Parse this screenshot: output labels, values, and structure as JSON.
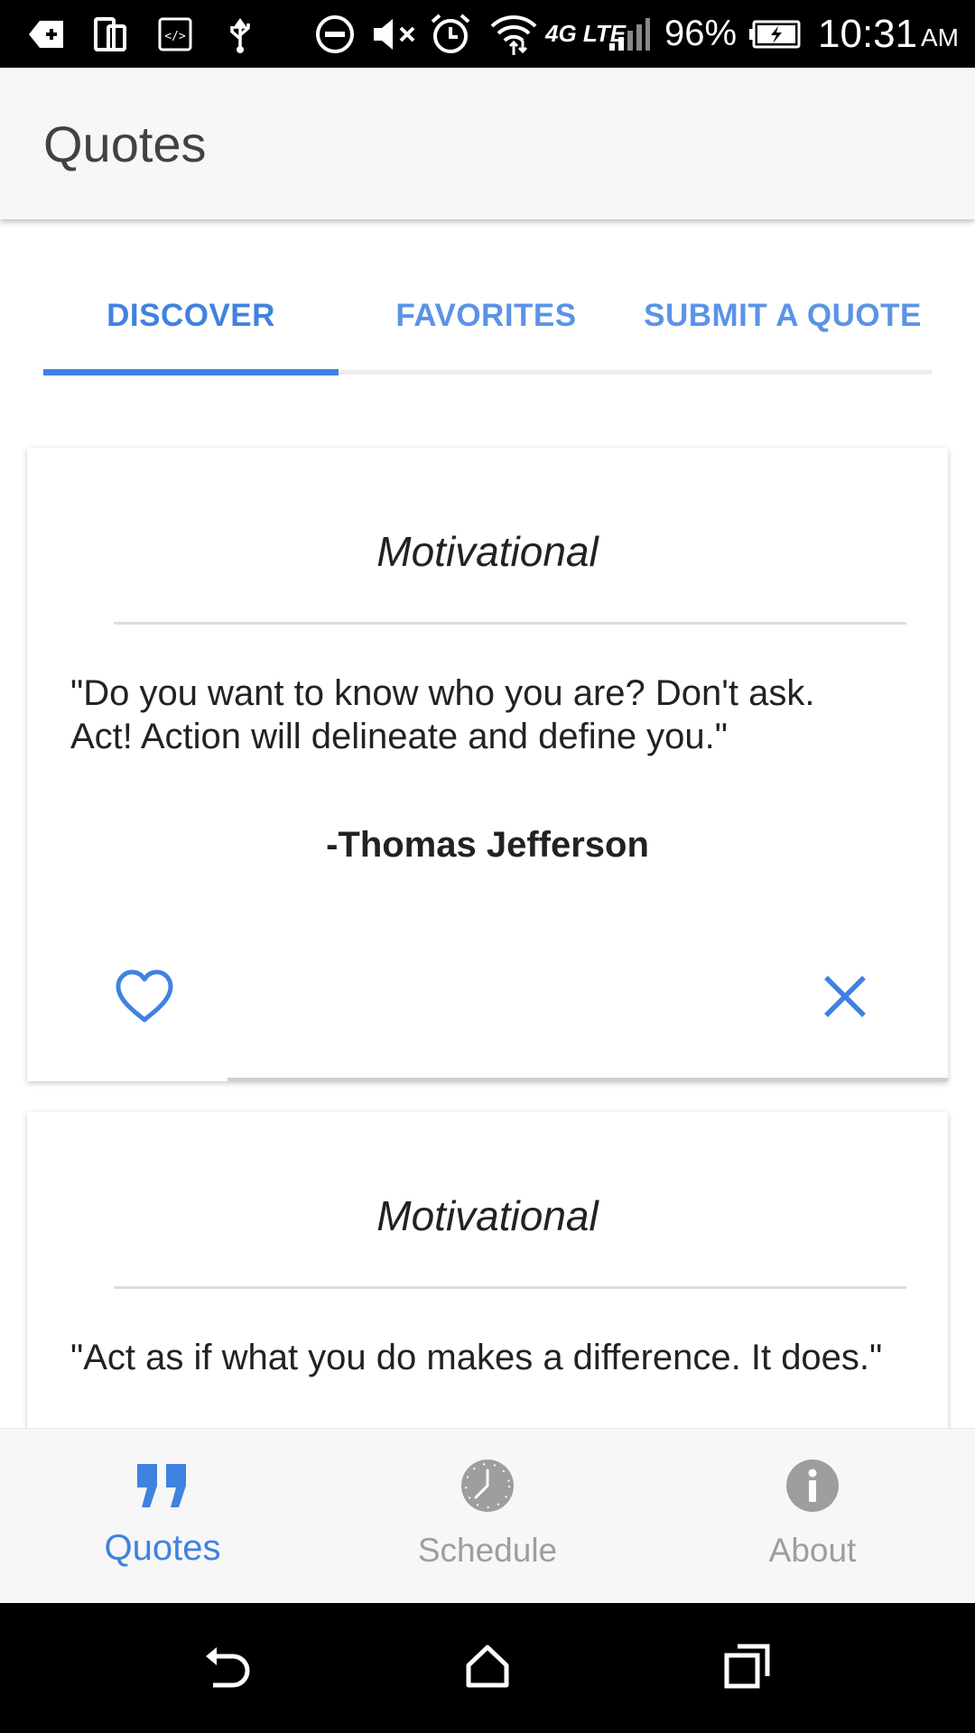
{
  "status_bar": {
    "battery_percent": "96%",
    "time": "10:31",
    "ampm": "AM",
    "network": "4G LTE",
    "icons": [
      "download-icon",
      "device-icon",
      "developer-icon",
      "usb-icon",
      "do-not-disturb-icon",
      "mute-icon",
      "alarm-icon",
      "wifi-icon",
      "signal-icon",
      "battery-charging-icon"
    ]
  },
  "app_bar": {
    "title": "Quotes"
  },
  "tabs": [
    {
      "label": "DISCOVER",
      "active": true
    },
    {
      "label": "FAVORITES",
      "active": false
    },
    {
      "label": "SUBMIT A QUOTE",
      "active": false
    }
  ],
  "cards": [
    {
      "category": "Motivational",
      "quote": "\"Do you want to know who you are? Don't ask. Act! Action will delineate and define you.\"",
      "author": "-Thomas Jefferson",
      "actions": [
        "heart-icon",
        "close-icon"
      ]
    },
    {
      "category": "Motivational",
      "quote": "\"Act as if what you do makes a difference. It does.\""
    }
  ],
  "bottom_nav": [
    {
      "label": "Quotes",
      "icon": "quote-icon",
      "active": true
    },
    {
      "label": "Schedule",
      "icon": "clock-icon",
      "active": false
    },
    {
      "label": "About",
      "icon": "info-icon",
      "active": false
    }
  ],
  "system_nav": [
    "back-icon",
    "home-icon",
    "recents-icon"
  ],
  "colors": {
    "accent": "#3f82e0",
    "inactive": "#9e9e9e",
    "app_bar": "#f7f7f7"
  }
}
